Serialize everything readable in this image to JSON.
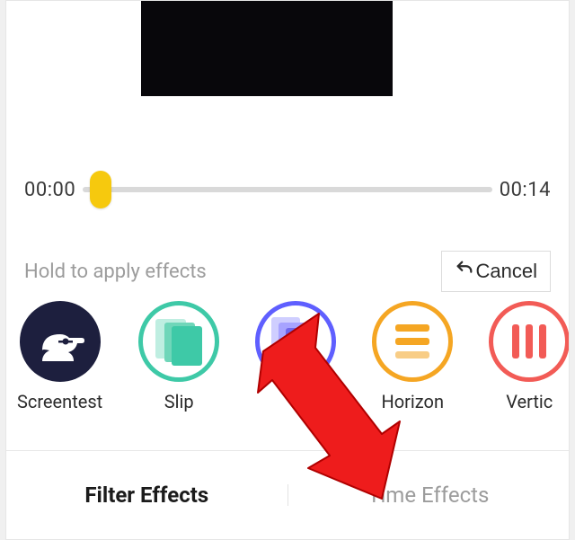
{
  "timeline": {
    "start": "00:00",
    "end": "00:14"
  },
  "hint": "Hold to apply effects",
  "cancel_label": "Cancel",
  "effects": {
    "screentest": "Screentest",
    "slip": "Slip",
    "unnamed": "",
    "horizon": "Horizon",
    "vertical": "Vertic"
  },
  "tabs": {
    "filter": "Filter Effects",
    "time": "Time Effects"
  }
}
